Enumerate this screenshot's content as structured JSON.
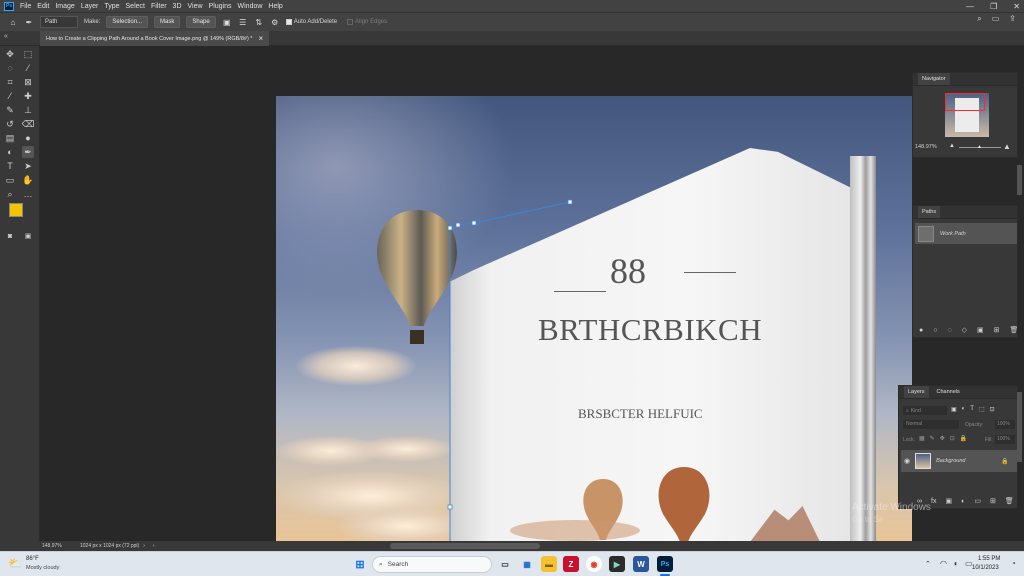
{
  "menu": {
    "logo": "Ps",
    "items": [
      "File",
      "Edit",
      "Image",
      "Layer",
      "Type",
      "Select",
      "Filter",
      "3D",
      "View",
      "Plugins",
      "Window",
      "Help"
    ]
  },
  "window_controls": {
    "minimize": "—",
    "restore": "❐",
    "close": "✕"
  },
  "options": {
    "mode_value": "Path",
    "make_label": "Make:",
    "selection_btn": "Selection...",
    "mask_btn": "Mask",
    "shape_btn": "Shape",
    "auto_add_delete": "Auto Add/Delete",
    "align_edges": "Align Edges"
  },
  "document_tab": {
    "title": "How to Create a Clipping Path Around a Book Cover Image.png @ 149% (RGB/8#) *",
    "close": "×"
  },
  "canvas_art": {
    "book_number": "88",
    "book_title": "BRTHCRBIKCH",
    "book_subtitle": "BRSBCTER HELFUIC"
  },
  "navigator": {
    "title": "Navigator",
    "zoom": "148.97%"
  },
  "paths": {
    "title": "Paths",
    "items": [
      {
        "name": "Work Path"
      }
    ]
  },
  "layers": {
    "tab_layers": "Layers",
    "tab_channels": "Channels",
    "filter_placeholder": "Kind",
    "blend_mode": "Normal",
    "opacity_label": "Opacity:",
    "opacity_value": "100%",
    "lock_label": "Lock:",
    "fill_label": "Fill:",
    "fill_value": "100%",
    "items": [
      {
        "name": "Background"
      }
    ]
  },
  "status": {
    "zoom": "148.97%",
    "doc_info": "1024 px x 1024 px (72 ppi)"
  },
  "watermark": {
    "line1": "Activate Windows",
    "line2": "Go to Se"
  },
  "taskbar": {
    "weather_temp": "86°F",
    "weather_desc": "Mostly cloudy",
    "search_placeholder": "Search",
    "time": "1:55 PM",
    "date": "10/1/2023"
  },
  "colors": {
    "foreground": "#f5c400",
    "background": "#000000",
    "path_stroke": "#3d86d8"
  }
}
